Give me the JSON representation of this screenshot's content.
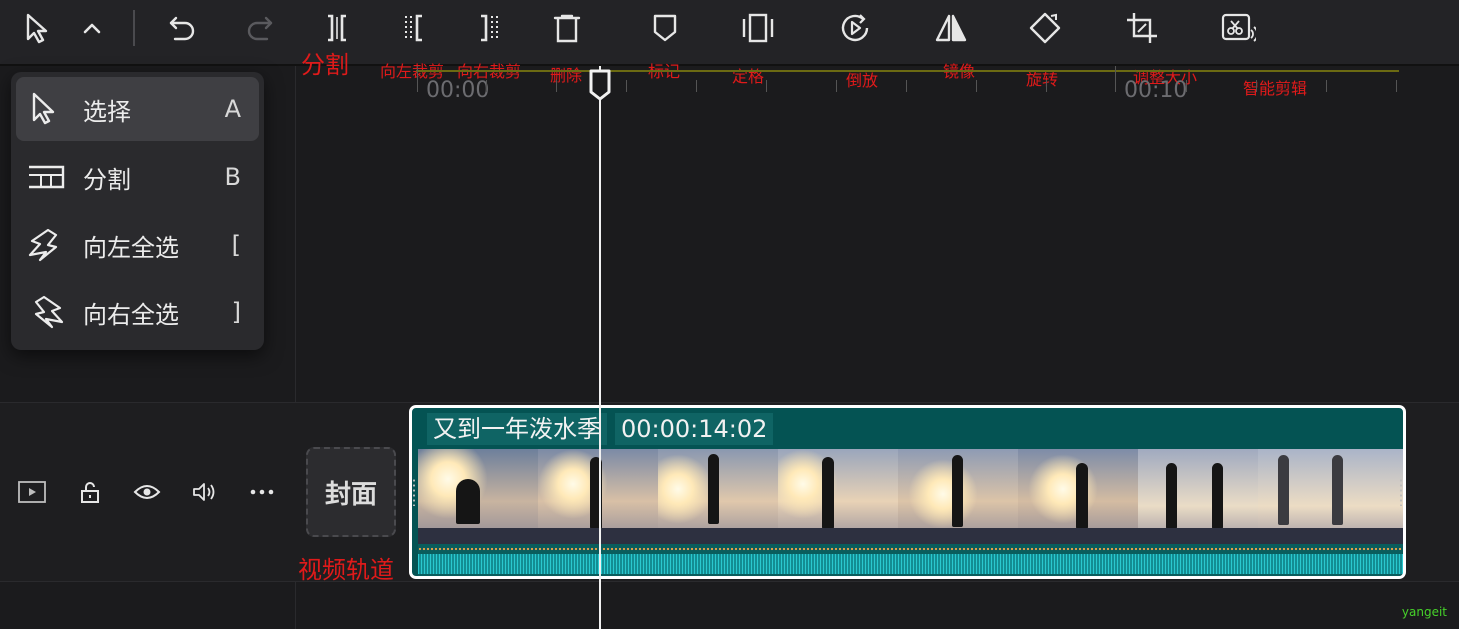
{
  "toolbar": {
    "buttons": [
      {
        "icon": "cursor-icon",
        "name": "select-tool-button"
      },
      {
        "icon": "chevron-up-icon",
        "name": "tool-menu-toggle"
      },
      {
        "icon": "undo-icon",
        "name": "undo-button"
      },
      {
        "icon": "redo-icon",
        "name": "redo-button"
      },
      {
        "icon": "split-icon",
        "name": "split-button"
      },
      {
        "icon": "trim-left-icon",
        "name": "trim-left-button"
      },
      {
        "icon": "trim-right-icon",
        "name": "trim-right-button"
      },
      {
        "icon": "delete-icon",
        "name": "delete-button"
      },
      {
        "icon": "marker-icon",
        "name": "marker-button"
      },
      {
        "icon": "freeze-frame-icon",
        "name": "freeze-frame-button"
      },
      {
        "icon": "reverse-icon",
        "name": "reverse-button"
      },
      {
        "icon": "mirror-icon",
        "name": "mirror-button"
      },
      {
        "icon": "rotate-icon",
        "name": "rotate-button"
      },
      {
        "icon": "crop-icon",
        "name": "crop-button"
      },
      {
        "icon": "smart-cut-icon",
        "name": "smart-cut-button"
      }
    ],
    "annotations": {
      "split": "分割",
      "trim_left": "向左裁剪",
      "trim_right": "向右裁剪",
      "delete": "删除",
      "marker": "标记",
      "freeze": "定格",
      "reverse": "倒放",
      "mirror": "镜像",
      "rotate": "旋转",
      "resize": "调整大小",
      "smart_cut": "智能剪辑"
    }
  },
  "ruler": {
    "start": "00:00",
    "mark": "00:10"
  },
  "menu": {
    "items": [
      {
        "label": "选择",
        "key": "A",
        "icon": "cursor-icon",
        "active": true
      },
      {
        "label": "分割",
        "key": "B",
        "icon": "split-blade-icon",
        "active": false
      },
      {
        "label": "向左全选",
        "key": "[",
        "icon": "select-left-icon",
        "active": false
      },
      {
        "label": "向右全选",
        "key": "]",
        "icon": "select-right-icon",
        "active": false
      }
    ]
  },
  "track": {
    "controls": [
      "track-thumbnail-icon",
      "lock-icon",
      "eye-icon",
      "volume-icon",
      "more-icon"
    ],
    "cover_label": "封面",
    "track_annotation": "视频轨道"
  },
  "clip": {
    "title": "又到一年泼水季",
    "duration": "00:00:14:02"
  },
  "watermark": "yangeit",
  "colors": {
    "annotation": "#e01a1a",
    "clip_bg": "#045353",
    "clip_border": "#ffffff",
    "waveform": "#2ac8cf",
    "ruler_line": "#6b6a12"
  }
}
